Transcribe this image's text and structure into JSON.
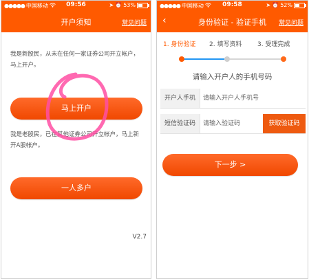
{
  "left_screen": {
    "status": {
      "carrier": "中国移动",
      "time": "09:56",
      "battery": "53%",
      "battery_level": 0.53
    },
    "nav": {
      "title": "开户须知",
      "help": "常见问题"
    },
    "new_user_text": "我是新股民，从未在任何一家证券公司开立帐户，马上开户。",
    "open_button": "马上开户",
    "old_user_text": "我是老股民，已在其他证券公司开立帐户，马上新开A股帐户。",
    "multi_button": "一人多户",
    "version": "V2.7"
  },
  "right_screen": {
    "status": {
      "carrier": "中国移动",
      "time": "09:58",
      "battery": "52%",
      "battery_level": 0.52
    },
    "nav": {
      "back_icon": "‹",
      "title": "身份验证 - 验证手机",
      "help": "常见问题"
    },
    "steps": [
      {
        "label": "1. 身份验证",
        "active": true
      },
      {
        "label": "2. 填写资料",
        "active": false
      },
      {
        "label": "3. 受理完成",
        "active": false
      }
    ],
    "prompt": "请输入开户人的手机号码",
    "phone_field": {
      "label": "开户人手机",
      "placeholder": "请输入开户人手机号",
      "value": ""
    },
    "code_field": {
      "label": "短信验证码",
      "placeholder": "请输入验证码",
      "value": ""
    },
    "get_code_button": "获取验证码",
    "next_button": "下一步 >"
  },
  "colors": {
    "brand_orange": "#ff5a00",
    "active_step": "#ff5a00",
    "inactive_step": "#cccccc",
    "progress_blue": "#2196f3",
    "annotation_pink": "#ff4fa3"
  }
}
